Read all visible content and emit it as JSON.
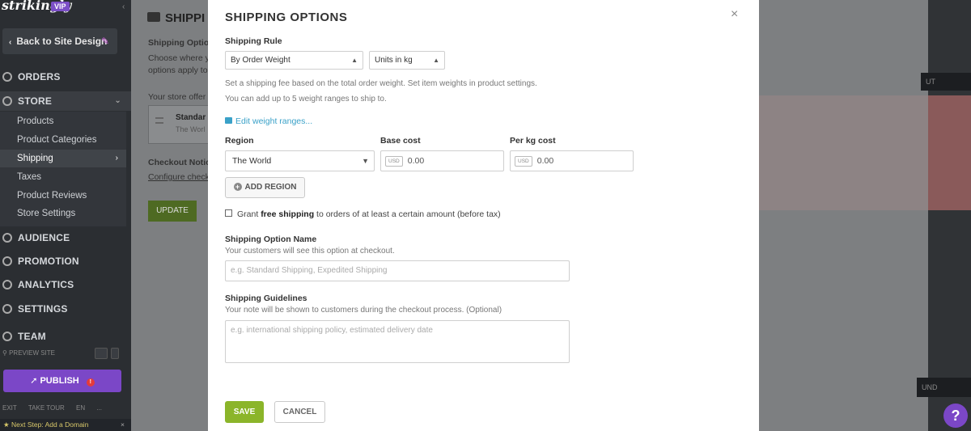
{
  "sidebar": {
    "logo": "strikingly",
    "vip_badge": "VIP",
    "back_label": "Back to Site Design",
    "nav": {
      "orders": "ORDERS",
      "store": "STORE",
      "audience": "AUDIENCE",
      "promotion": "PROMOTION",
      "analytics": "ANALYTICS",
      "settings": "SETTINGS",
      "team": "TEAM"
    },
    "store_items": [
      "Products",
      "Product Categories",
      "Shipping",
      "Taxes",
      "Product Reviews",
      "Store Settings"
    ],
    "preview_label": "PREVIEW SITE",
    "publish_label": "PUBLISH",
    "publish_badge": "!",
    "bottom_links": [
      "EXIT",
      "TAKE TOUR",
      "EN",
      "..."
    ],
    "next_step": "Next Step: Add a Domain"
  },
  "background_page": {
    "title": "SHIPPI",
    "options_heading": "Shipping Optio",
    "desc_line1": "Choose where y",
    "desc_line2": "options apply to",
    "store_offers": "Your store offer",
    "card_title": "Standar",
    "card_sub": "The Worl",
    "checkout_heading": "Checkout Notic",
    "checkout_link": "Configure check",
    "update_label": "UPDATE"
  },
  "right_background": {
    "bar_label": "UT",
    "bar2_label": "UND",
    "help_label": "?"
  },
  "modal": {
    "title": "SHIPPING OPTIONS",
    "close": "×",
    "shipping_rule_label": "Shipping Rule",
    "rule_select_value": "By Order Weight",
    "unit_select_value": "Units in kg",
    "help_line1": "Set a shipping fee based on the total order weight. Set item weights in product settings.",
    "help_line2": "You can add up to 5 weight ranges to ship to.",
    "edit_ranges_link": "Edit weight ranges...",
    "region_label": "Region",
    "base_cost_label": "Base cost",
    "per_kg_label": "Per kg cost",
    "region_value": "The World",
    "currency": "USD",
    "base_cost_value": "0.00",
    "per_kg_value": "0.00",
    "add_region_label": "ADD REGION",
    "free_shipping": {
      "prefix": "Grant ",
      "bold": "free shipping",
      "suffix": " to orders of at least a certain amount (before tax)",
      "checked": false
    },
    "option_name_label": "Shipping Option Name",
    "option_name_help": "Your customers will see this option at checkout.",
    "option_name_placeholder": "e.g. Standard Shipping, Expedited Shipping",
    "guidelines_label": "Shipping Guidelines",
    "guidelines_help": "Your note will be shown to customers during the checkout process. (Optional)",
    "guidelines_placeholder": "e.g. international shipping policy, estimated delivery date",
    "save_label": "SAVE",
    "cancel_label": "CANCEL"
  },
  "colors": {
    "accent_green": "#8bb52a",
    "link_blue": "#3aa1c8",
    "publish_purple": "#7b47c7"
  }
}
